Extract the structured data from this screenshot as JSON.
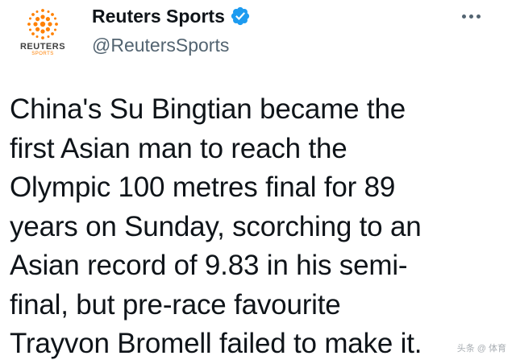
{
  "tweet": {
    "author": {
      "display_name": "Reuters Sports",
      "handle": "@ReutersSports",
      "verified": true,
      "avatar": {
        "brand": "REUTERS",
        "sub": "SPORTS",
        "icon": "reuters-dot-logo-icon",
        "accent_color": "#ff8000"
      }
    },
    "text": "China's Su Bingtian became the\nfirst Asian man to reach the\nOlympic 100 metres final for 89\nyears on Sunday, scorching to an\nAsian record of 9.83 in his semi-\nfinal, but pre-race favourite\nTrayvon Bromell failed to make it.",
    "more_menu_icon": "more-options-icon",
    "verified_color": "#1d9bf0"
  },
  "watermark": "头条 @ 体育"
}
